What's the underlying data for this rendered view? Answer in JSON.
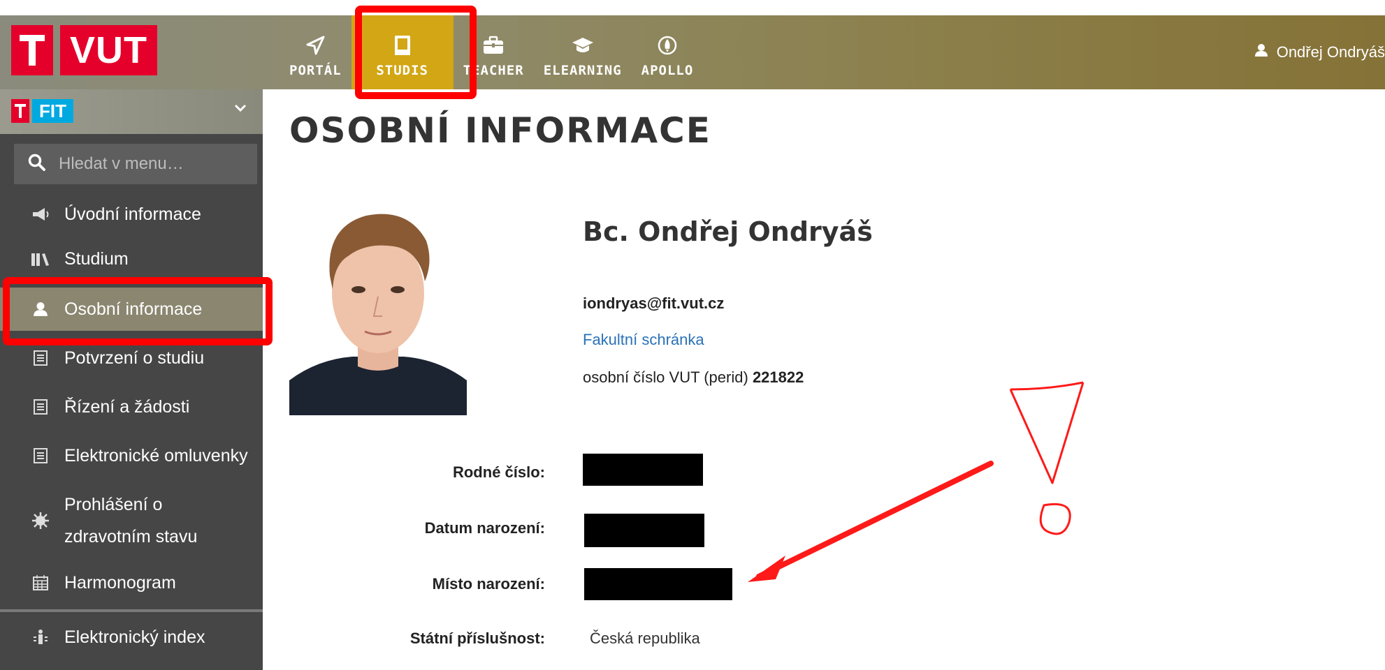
{
  "header": {
    "logo_text": "VUT",
    "nav": [
      {
        "label": "PORTÁL",
        "icon": "send-icon"
      },
      {
        "label": "STUDIS",
        "icon": "book-icon"
      },
      {
        "label": "TEACHER",
        "icon": "briefcase-icon"
      },
      {
        "label": "ELEARNING",
        "icon": "graduation-cap-icon"
      },
      {
        "label": "APOLLO",
        "icon": "rocket-icon"
      }
    ],
    "active_nav": "STUDIS",
    "user_name": "Ondřej Ondryáš"
  },
  "sidebar": {
    "faculty_logo_text": "FIT",
    "search_placeholder": "Hledat v menu…",
    "items": [
      {
        "label": "Úvodní informace",
        "icon": "megaphone-icon"
      },
      {
        "label": "Studium",
        "icon": "books-icon"
      },
      {
        "label": "Osobní informace",
        "icon": "user-icon"
      },
      {
        "label": "Potvrzení o studiu",
        "icon": "document-icon"
      },
      {
        "label": "Řízení a žádosti",
        "icon": "document-icon"
      },
      {
        "label": "Elektronické omluvenky",
        "icon": "document-icon"
      },
      {
        "label_line1": "Prohlášení o",
        "label_line2": "zdravotním stavu",
        "icon": "virus-icon"
      },
      {
        "label": "Harmonogram",
        "icon": "calendar-icon"
      },
      {
        "label": "Elektronický index",
        "icon": "index-icon"
      }
    ],
    "active_item": "Osobní informace"
  },
  "main": {
    "title": "OSOBNÍ INFORMACE",
    "name": "Bc. Ondřej Ondryáš",
    "email": "iondryas@fit.vut.cz",
    "mailbox_link": "Fakultní schránka",
    "perid_label": "osobní číslo VUT (perid)",
    "perid_value": "221822",
    "fields": [
      {
        "label": "Rodné číslo:",
        "value": null
      },
      {
        "label": "Datum narození:",
        "value": null
      },
      {
        "label": "Místo narození:",
        "value": null
      },
      {
        "label": "Státní příslušnost:",
        "value": "Česká republika"
      }
    ]
  },
  "colors": {
    "vut_red": "#e4002b",
    "fit_blue": "#00a9e0",
    "active_nav_gold": "#d2a615",
    "annotation_red": "#ff0000",
    "link_blue": "#2a72b8"
  }
}
